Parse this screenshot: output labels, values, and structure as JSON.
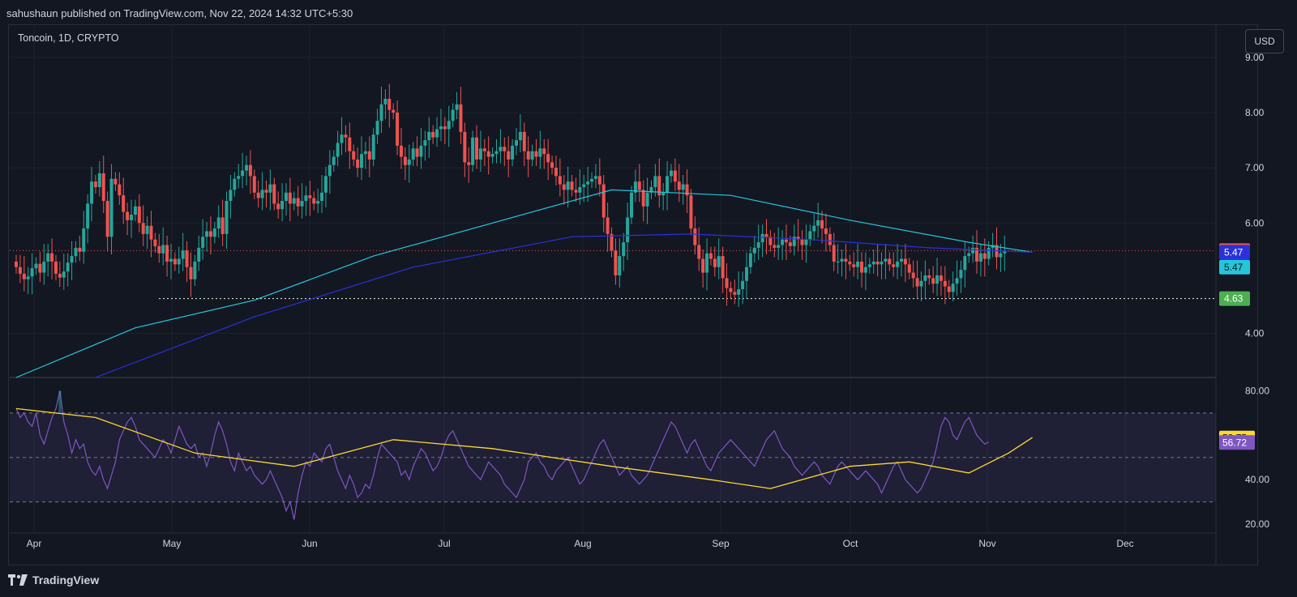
{
  "header": {
    "published": "sahushaun published on TradingView.com, Nov 22, 2024 14:32 UTC+5:30"
  },
  "symbol_label": "Toncoin, 1D, CRYPTO",
  "currency_button": "USD",
  "footer": {
    "brand": "TradingView"
  },
  "colors": {
    "bg": "#131722",
    "grid": "#1e222d",
    "up": "#26a69a",
    "down": "#ef5350",
    "ema_cyan": "#26c6da",
    "ema_blue": "#2932d8",
    "rsi_line": "#7e57c2",
    "rsi_ma": "#fdd835",
    "rsi_band": "#7e57c2",
    "support": "#c8e6c9"
  },
  "chart_data": [
    {
      "type": "candlestick",
      "title": "Toncoin, 1D, CRYPTO",
      "ylim": [
        3.2,
        9.6
      ],
      "y_ticks": [
        "9.00",
        "8.00",
        "7.00",
        "6.00",
        "4.00"
      ],
      "x_ticks": [
        "Apr",
        "May",
        "Jun",
        "Jul",
        "Aug",
        "Sep",
        "Oct",
        "Nov",
        "Dec"
      ],
      "close": [
        5.2,
        5.08,
        4.98,
        5.03,
        5.18,
        5.26,
        5.1,
        5.3,
        5.45,
        5.3,
        5.08,
        5.01,
        5.12,
        5.28,
        5.4,
        5.55,
        5.48,
        5.9,
        6.35,
        6.75,
        6.65,
        6.9,
        6.4,
        5.75,
        6.8,
        6.7,
        6.5,
        6.2,
        6.05,
        6.15,
        6.3,
        6.0,
        5.8,
        5.95,
        5.7,
        5.58,
        5.45,
        5.6,
        5.3,
        5.35,
        5.25,
        5.35,
        5.5,
        5.2,
        4.98,
        5.3,
        5.55,
        5.75,
        5.85,
        5.75,
        5.9,
        6.1,
        5.8,
        6.4,
        6.6,
        6.8,
        6.85,
        6.95,
        7.05,
        6.85,
        6.55,
        6.45,
        6.6,
        6.55,
        6.7,
        6.35,
        6.25,
        6.4,
        6.55,
        6.35,
        6.45,
        6.3,
        6.4,
        6.5,
        6.45,
        6.35,
        6.4,
        6.55,
        6.85,
        7.05,
        7.2,
        7.45,
        7.6,
        7.55,
        7.3,
        7.15,
        7.0,
        7.25,
        7.3,
        7.15,
        7.6,
        7.85,
        8.15,
        8.25,
        8.05,
        8.0,
        7.4,
        7.2,
        7.05,
        7.15,
        7.35,
        7.2,
        7.4,
        7.5,
        7.65,
        7.55,
        7.7,
        7.75,
        7.7,
        7.85,
        8.05,
        8.15,
        7.65,
        7.1,
        7.05,
        7.55,
        7.15,
        7.35,
        7.3,
        7.2,
        7.25,
        7.3,
        7.38,
        7.3,
        7.15,
        7.4,
        7.5,
        7.65,
        7.3,
        7.15,
        7.3,
        7.2,
        7.35,
        7.25,
        7.1,
        7.0,
        6.85,
        6.7,
        6.6,
        6.75,
        6.6,
        6.55,
        6.65,
        6.7,
        6.75,
        6.8,
        6.85,
        6.7,
        6.1,
        5.8,
        5.5,
        5.05,
        5.4,
        5.65,
        6.1,
        6.55,
        6.75,
        6.6,
        6.3,
        6.55,
        6.65,
        6.85,
        6.5,
        6.55,
        6.85,
        6.95,
        6.75,
        6.6,
        6.7,
        6.5,
        5.9,
        5.6,
        5.35,
        5.1,
        5.45,
        5.35,
        5.2,
        5.4,
        5.0,
        4.82,
        4.75,
        4.7,
        4.8,
        4.95,
        5.2,
        5.45,
        5.55,
        5.65,
        5.8,
        5.75,
        5.6,
        5.55,
        5.6,
        5.7,
        5.65,
        5.58,
        5.75,
        5.7,
        5.6,
        5.7,
        5.85,
        5.95,
        6.05,
        5.9,
        5.8,
        5.6,
        5.3,
        5.3,
        5.35,
        5.3,
        5.25,
        5.2,
        5.3,
        5.1,
        5.2,
        5.25,
        5.3,
        5.25,
        5.3,
        5.35,
        5.25,
        5.2,
        5.3,
        5.35,
        5.25,
        5.1,
        5.0,
        4.85,
        4.95,
        5.05,
        5.0,
        4.9,
        5.05,
        4.95,
        4.85,
        4.75,
        4.9,
        5.0,
        5.15,
        5.4,
        5.45,
        5.55,
        5.3,
        5.45,
        5.35,
        5.55,
        5.6,
        5.38,
        5.45,
        5.5
      ]
    },
    {
      "type": "line",
      "name": "EMA",
      "x": [
        0,
        30,
        60,
        90,
        120,
        150,
        180,
        210,
        240,
        256
      ],
      "y": [
        3.2,
        4.1,
        4.6,
        5.4,
        6.0,
        6.6,
        6.5,
        6.05,
        5.65,
        5.47
      ]
    },
    {
      "type": "line",
      "name": "EMA",
      "x": [
        20,
        60,
        100,
        140,
        170,
        200,
        230,
        256
      ],
      "y": [
        3.2,
        4.3,
        5.2,
        5.75,
        5.8,
        5.7,
        5.55,
        5.47
      ]
    },
    {
      "type": "price_labels",
      "labels": [
        {
          "value": 5.5,
          "text": "5.50",
          "color": "#ef5350"
        },
        {
          "value": 5.47,
          "text": "5.47",
          "color": "#2932d8"
        },
        {
          "value": 5.2,
          "text": "5.47",
          "color": "#26c6da"
        },
        {
          "value": 4.63,
          "text": "4.63",
          "color": "#4caf50"
        }
      ],
      "support_level": 4.63
    },
    {
      "type": "line",
      "name": "RSI",
      "ylim": [
        16,
        86
      ],
      "y_ticks": [
        "80.00",
        "40.00",
        "20.00"
      ],
      "band": [
        30,
        70
      ],
      "midline": 50,
      "rsi": [
        72,
        68,
        70,
        66,
        64,
        70,
        60,
        56,
        62,
        68,
        72,
        80,
        66,
        60,
        52,
        58,
        54,
        56,
        48,
        44,
        42,
        46,
        40,
        36,
        42,
        48,
        58,
        62,
        66,
        68,
        64,
        58,
        56,
        54,
        52,
        50,
        54,
        58,
        56,
        52,
        58,
        64,
        60,
        56,
        54,
        56,
        50,
        52,
        46,
        52,
        60,
        66,
        62,
        56,
        48,
        44,
        52,
        48,
        44,
        46,
        42,
        40,
        38,
        40,
        44,
        40,
        36,
        32,
        26,
        30,
        22,
        34,
        42,
        48,
        46,
        52,
        50,
        48,
        54,
        56,
        50,
        44,
        40,
        36,
        42,
        38,
        32,
        34,
        38,
        36,
        42,
        50,
        56,
        54,
        52,
        50,
        48,
        42,
        44,
        40,
        46,
        50,
        54,
        52,
        48,
        44,
        46,
        50,
        56,
        60,
        62,
        58,
        54,
        50,
        46,
        44,
        42,
        40,
        44,
        48,
        46,
        44,
        42,
        38,
        36,
        34,
        32,
        36,
        40,
        48,
        50,
        52,
        48,
        46,
        42,
        40,
        44,
        46,
        48,
        50,
        46,
        42,
        38,
        40,
        44,
        48,
        52,
        56,
        58,
        54,
        50,
        46,
        42,
        44,
        46,
        42,
        40,
        38,
        40,
        42,
        46,
        50,
        54,
        58,
        62,
        66,
        64,
        60,
        56,
        52,
        56,
        58,
        54,
        50,
        46,
        44,
        48,
        52,
        54,
        56,
        58,
        56,
        54,
        52,
        50,
        48,
        46,
        50,
        54,
        58,
        60,
        62,
        58,
        54,
        52,
        50,
        46,
        44,
        42,
        44,
        46,
        48,
        46,
        42,
        40,
        38,
        42,
        46,
        48,
        46,
        44,
        42,
        40,
        42,
        44,
        42,
        40,
        38,
        34,
        38,
        42,
        46,
        48,
        44,
        40,
        38,
        36,
        34,
        36,
        40,
        44,
        48,
        56,
        64,
        68,
        66,
        60,
        58,
        62,
        66,
        68,
        64,
        60,
        58,
        56,
        57
      ],
      "rsi_ma_points": [
        [
          0,
          72
        ],
        [
          20,
          68
        ],
        [
          45,
          52
        ],
        [
          70,
          46
        ],
        [
          95,
          58
        ],
        [
          120,
          54
        ],
        [
          150,
          46
        ],
        [
          175,
          40
        ],
        [
          190,
          36
        ],
        [
          210,
          46
        ],
        [
          225,
          48
        ],
        [
          240,
          43
        ],
        [
          250,
          52
        ],
        [
          256,
          59
        ]
      ]
    },
    {
      "type": "price_labels",
      "labels": [
        {
          "value": 58.75,
          "text": "58.75",
          "color": "#fdd835"
        },
        {
          "value": 56.72,
          "text": "56.72",
          "color": "#7e57c2"
        }
      ]
    }
  ]
}
